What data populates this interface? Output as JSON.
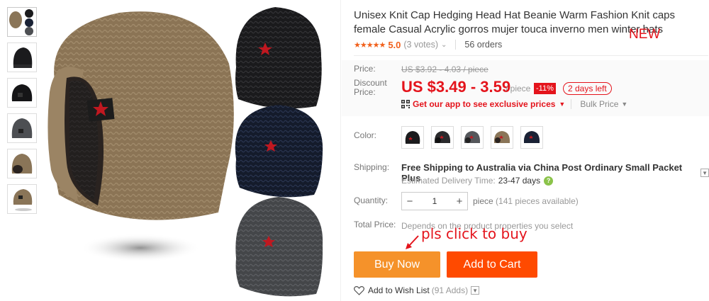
{
  "product": {
    "title": "Unisex Knit Cap Hedging Head Hat Beanie Warm Fashion Knit caps female Casual Acrylic gorros mujer touca inverno men winter hats",
    "new_badge": "NEW",
    "rating": {
      "stars": "★★★★★",
      "value": "5.0",
      "votes": "(3 votes)",
      "chevron": "⌄",
      "orders": "56 orders"
    }
  },
  "price": {
    "label": "Price:",
    "original": "US $3.92 - 4.03 / piece",
    "discount_label": "Discount Price:",
    "sale": "US $3.49 - 3.59",
    "per_piece": "/ piece",
    "discount_pct": "-11%",
    "days_left": "2 days left",
    "app_link": "Get our app to see exclusive prices",
    "bulk": "Bulk Price"
  },
  "color": {
    "label": "Color:",
    "swatches": [
      {
        "name": "black",
        "hex": "#1b1b1d"
      },
      {
        "name": "black-2",
        "hex": "#2a2a2c"
      },
      {
        "name": "gray",
        "hex": "#55575b"
      },
      {
        "name": "khaki",
        "hex": "#8a7558"
      },
      {
        "name": "navy",
        "hex": "#1a2235"
      }
    ]
  },
  "shipping": {
    "label": "Shipping:",
    "text": "Free Shipping to Australia via China Post Ordinary Small Packet Plus",
    "delivery_label": "Estimated Delivery Time:",
    "delivery_value": "23-47 days",
    "help": "?"
  },
  "quantity": {
    "label": "Quantity:",
    "minus": "−",
    "value": "1",
    "plus": "+",
    "pieces": "piece",
    "available": "(141 pieces available)"
  },
  "total": {
    "label": "Total Price:",
    "note": "Depends on the product properties you select"
  },
  "annotation": {
    "text": "pls click to buy"
  },
  "buttons": {
    "buy_now": "Buy Now",
    "add_to_cart": "Add to Cart"
  },
  "wishlist": {
    "label": "Add to Wish List",
    "count": "(91 Adds)"
  },
  "colors": {
    "accent_red": "#e4141c",
    "buy_orange": "#f5922a",
    "cart_orange": "#ff4a00",
    "rating_orange": "#f1601b"
  }
}
